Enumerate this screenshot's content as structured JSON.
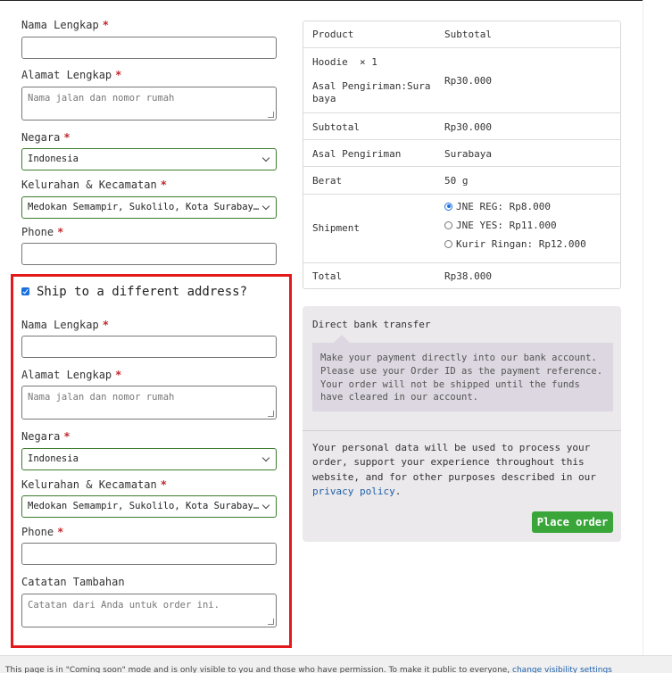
{
  "billing": {
    "name_label": "Nama Lengkap",
    "address_label": "Alamat Lengkap",
    "address_placeholder": "Nama jalan dan nomor rumah",
    "country_label": "Negara",
    "country_value": "Indonesia",
    "district_label": "Kelurahan & Kecamatan",
    "district_value": "Medokan Semampir, Sukolilo, Kota Surabaya, Jawa Timur",
    "phone_label": "Phone",
    "required_mark": "*"
  },
  "shipping": {
    "checkbox_label": "Ship to a different address?",
    "checked": true,
    "name_label": "Nama Lengkap",
    "address_label": "Alamat Lengkap",
    "address_placeholder": "Nama jalan dan nomor rumah",
    "country_label": "Negara",
    "country_value": "Indonesia",
    "district_label": "Kelurahan & Kecamatan",
    "district_value": "Medokan Semampir, Sukolilo, Kota Surabaya, Jawa Timur",
    "phone_label": "Phone",
    "notes_label": "Catatan Tambahan",
    "notes_placeholder": "Catatan dari Anda untuk order ini.",
    "highlight_color": "#e3191c"
  },
  "order": {
    "header_product": "Product",
    "header_subtotal": "Subtotal",
    "item_name": "Hoodie",
    "item_qty": "× 1",
    "item_origin_label": "Asal Pengiriman:",
    "item_origin_value_1": "Sura",
    "item_origin_value_2": "baya",
    "item_price": "Rp30.000",
    "subtotal_label": "Subtotal",
    "subtotal_value": "Rp30.000",
    "origin_label": "Asal Pengiriman",
    "origin_value": "Surabaya",
    "weight_label": "Berat",
    "weight_value": "50 g",
    "shipment_label": "Shipment",
    "shipment_options": [
      {
        "label": "JNE REG: Rp8.000",
        "selected": true
      },
      {
        "label": "JNE YES: Rp11.000",
        "selected": false
      },
      {
        "label": "Kurir Ringan: Rp12.000",
        "selected": false
      }
    ],
    "total_label": "Total",
    "total_value": "Rp38.000"
  },
  "payment": {
    "method": "Direct bank transfer",
    "description": "Make your payment directly into our bank account. Please use your Order ID as the payment reference. Your order will not be shipped until the funds have cleared in our account.",
    "privacy_text": "Your personal data will be used to process your order, support your experience throughout this website, and for other purposes described in our ",
    "privacy_link": "privacy policy",
    "privacy_end": ".",
    "place_order": "Place order",
    "button_color": "#3aa63a"
  },
  "notice": {
    "text": "This page is in \"Coming soon\" mode and is only visible to you and those who have permission. To make it public to everyone, ",
    "link": "change visibility settings"
  }
}
